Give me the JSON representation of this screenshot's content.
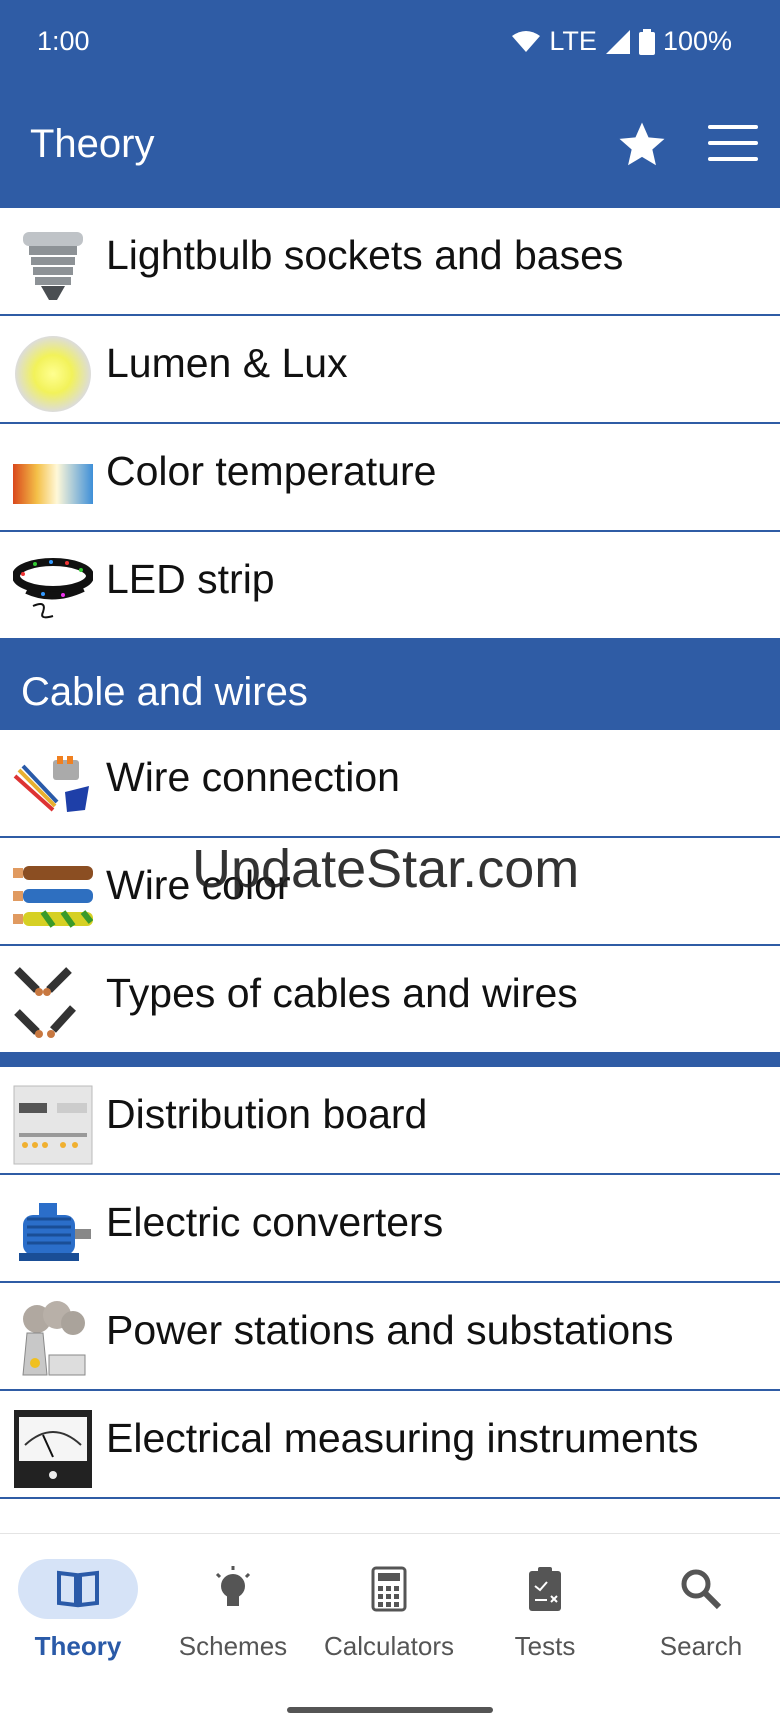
{
  "status": {
    "time": "1:00",
    "network": "LTE",
    "battery": "100%"
  },
  "appbar": {
    "title": "Theory"
  },
  "rows_top": [
    {
      "label": "Lightbulb sockets and bases",
      "icon": "lightbulb-socket-icon"
    },
    {
      "label": "Lumen & Lux",
      "icon": "lumen-icon"
    },
    {
      "label": "Color temperature",
      "icon": "color-temperature-icon"
    },
    {
      "label": "LED strip",
      "icon": "led-strip-icon"
    }
  ],
  "section": {
    "title": "Cable and wires"
  },
  "rows_cable": [
    {
      "label": "Wire connection",
      "icon": "wire-connection-icon"
    },
    {
      "label": "Wire color",
      "icon": "wire-color-icon"
    },
    {
      "label": "Types of cables and wires",
      "icon": "cable-types-icon"
    }
  ],
  "rows_bottom": [
    {
      "label": "Distribution board",
      "icon": "distribution-board-icon"
    },
    {
      "label": "Electric converters",
      "icon": "electric-motor-icon"
    },
    {
      "label": "Power stations and substations",
      "icon": "power-station-icon"
    },
    {
      "label": "Electrical measuring instruments",
      "icon": "meter-icon"
    }
  ],
  "watermark": "UpdateStar.com",
  "nav": [
    {
      "label": "Theory",
      "icon": "book-icon",
      "active": true
    },
    {
      "label": "Schemes",
      "icon": "lightbulb-icon",
      "active": false
    },
    {
      "label": "Calculators",
      "icon": "calculator-icon",
      "active": false
    },
    {
      "label": "Tests",
      "icon": "clipboard-icon",
      "active": false
    },
    {
      "label": "Search",
      "icon": "search-icon",
      "active": false
    }
  ],
  "colors": {
    "primary": "#2f5ca5",
    "active_pill": "#d6e3f7",
    "active_text": "#2a5aa8"
  }
}
